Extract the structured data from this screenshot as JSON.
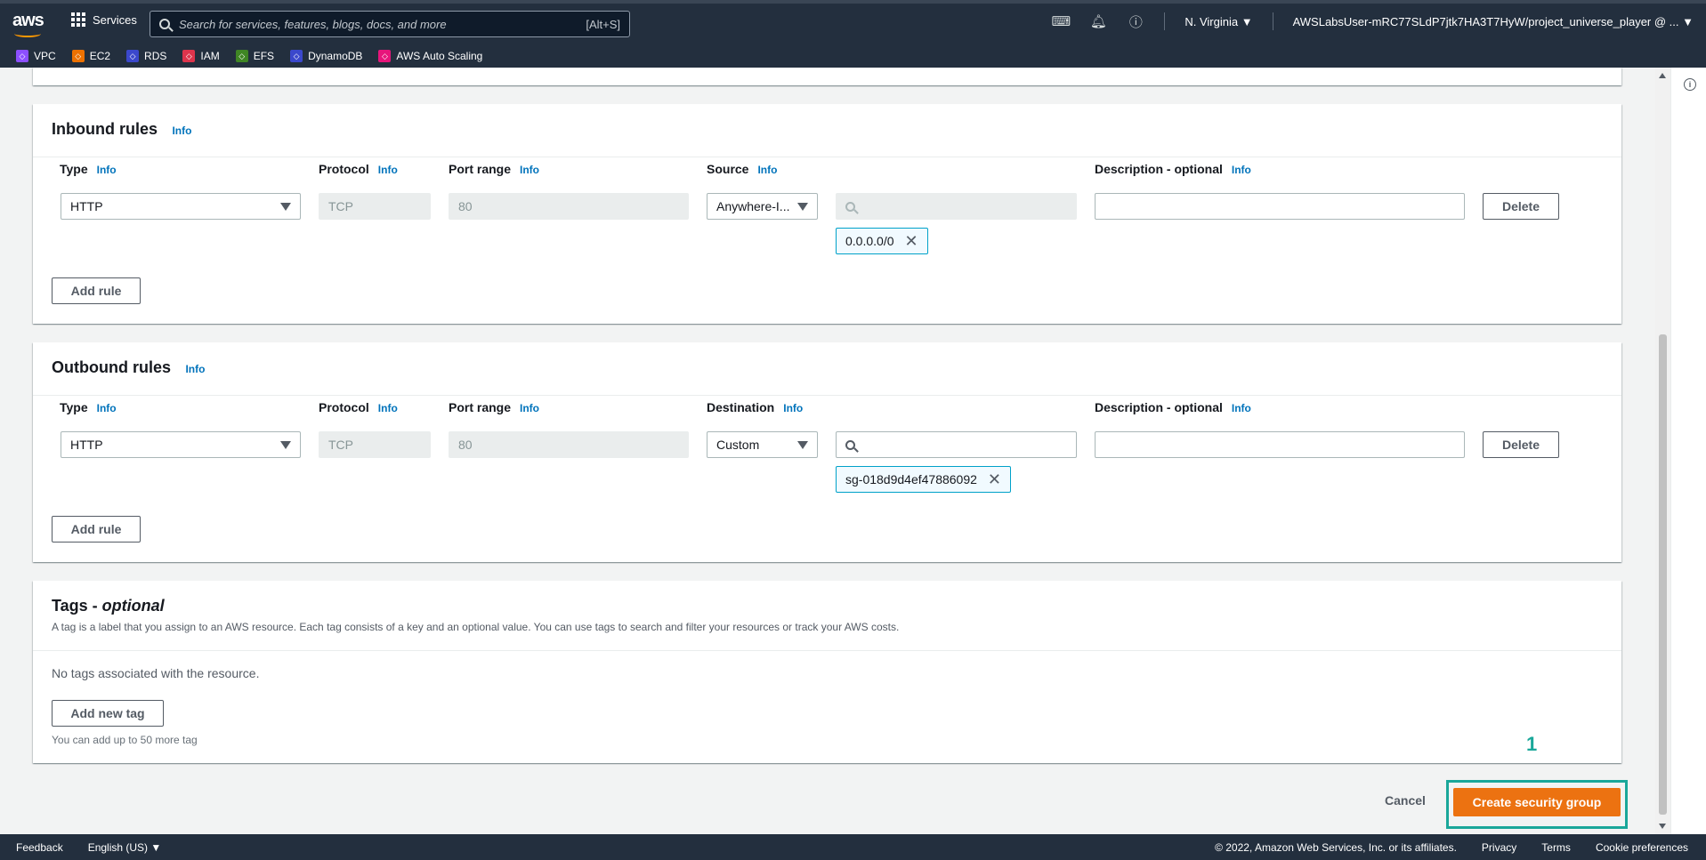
{
  "header": {
    "logo": "aws",
    "services_label": "Services",
    "search_placeholder": "Search for services, features, blogs, docs, and more",
    "search_hint": "[Alt+S]",
    "region": "N. Virginia ▼",
    "account": "AWSLabsUser-mRC77SLdP7jtk7HA3T7HyW/project_universe_player @ ... ▼"
  },
  "favorites": [
    {
      "label": "VPC",
      "color": "#8c4fff"
    },
    {
      "label": "EC2",
      "color": "#ed7100"
    },
    {
      "label": "RDS",
      "color": "#3b48cc"
    },
    {
      "label": "IAM",
      "color": "#dd344c"
    },
    {
      "label": "EFS",
      "color": "#3f8624"
    },
    {
      "label": "DynamoDB",
      "color": "#3b48cc"
    },
    {
      "label": "AWS Auto Scaling",
      "color": "#e7157b"
    }
  ],
  "inbound": {
    "title": "Inbound rules",
    "info": "Info",
    "cols": {
      "type": "Type",
      "protocol": "Protocol",
      "port": "Port range",
      "source": "Source",
      "desc": "Description - optional"
    },
    "rule": {
      "type": "HTTP",
      "protocol": "TCP",
      "port": "80",
      "source": "Anywhere-I...",
      "token": "0.0.0.0/0"
    },
    "delete": "Delete",
    "add_rule": "Add rule"
  },
  "outbound": {
    "title": "Outbound rules",
    "info": "Info",
    "cols": {
      "type": "Type",
      "protocol": "Protocol",
      "port": "Port range",
      "dest": "Destination",
      "desc": "Description - optional"
    },
    "rule": {
      "type": "HTTP",
      "protocol": "TCP",
      "port": "80",
      "dest": "Custom",
      "token": "sg-018d9d4ef47886092"
    },
    "delete": "Delete",
    "add_rule": "Add rule"
  },
  "tags": {
    "title": "Tags - ",
    "title_optional": "optional",
    "description": "A tag is a label that you assign to an AWS resource. Each tag consists of a key and an optional value. You can use tags to search and filter your resources or track your AWS costs.",
    "empty": "No tags associated with the resource.",
    "add_tag": "Add new tag",
    "limit": "You can add up to 50 more tag"
  },
  "actions": {
    "cancel": "Cancel",
    "create": "Create security group",
    "annotation": "1",
    "highlight_color": "#1aa79a",
    "primary_color": "#ec7211"
  },
  "footer": {
    "feedback": "Feedback",
    "language": "English (US) ▼",
    "copyright": "© 2022, Amazon Web Services, Inc. or its affiliates.",
    "privacy": "Privacy",
    "terms": "Terms",
    "cookies": "Cookie preferences"
  }
}
